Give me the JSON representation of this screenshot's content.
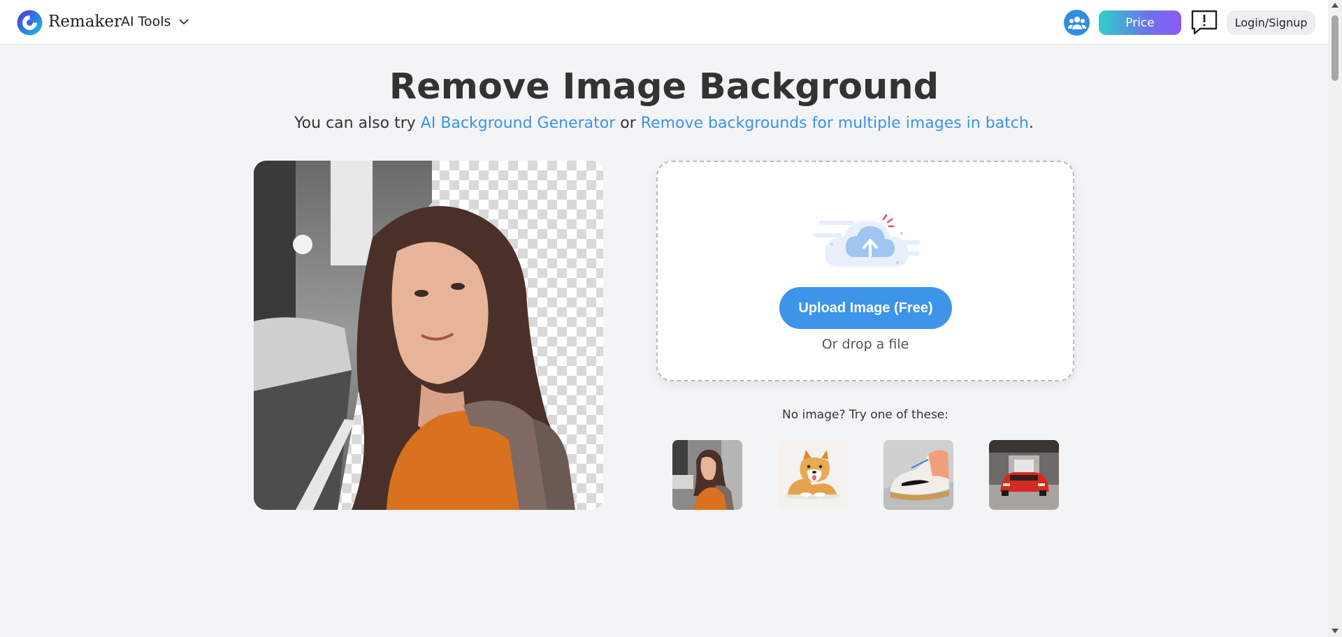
{
  "header": {
    "brand": "Remaker",
    "ai_tools_label": "AI Tools",
    "price_label": "Price",
    "login_label": "Login/Signup",
    "icons": {
      "logo": "remaker-logo-icon",
      "dropdown": "chevron-down-icon",
      "community": "community-icon",
      "feedback": "feedback-icon"
    }
  },
  "main": {
    "title": "Remove Image Background",
    "subtitle_prefix": "You can also try ",
    "link1": "AI Background Generator",
    "subtitle_mid": " or ",
    "link2": "Remove backgrounds for multiple images in batch",
    "subtitle_suffix": "."
  },
  "upload": {
    "button_label": "Upload Image (Free)",
    "drop_text": "Or drop a file"
  },
  "samples": {
    "label": "No image? Try one of these:",
    "items": [
      "woman-sample",
      "dog-sample",
      "sneaker-sample",
      "car-sample"
    ]
  },
  "colors": {
    "accent": "#3d95ea",
    "link": "#3b93e4",
    "background": "#f3f4f6"
  }
}
